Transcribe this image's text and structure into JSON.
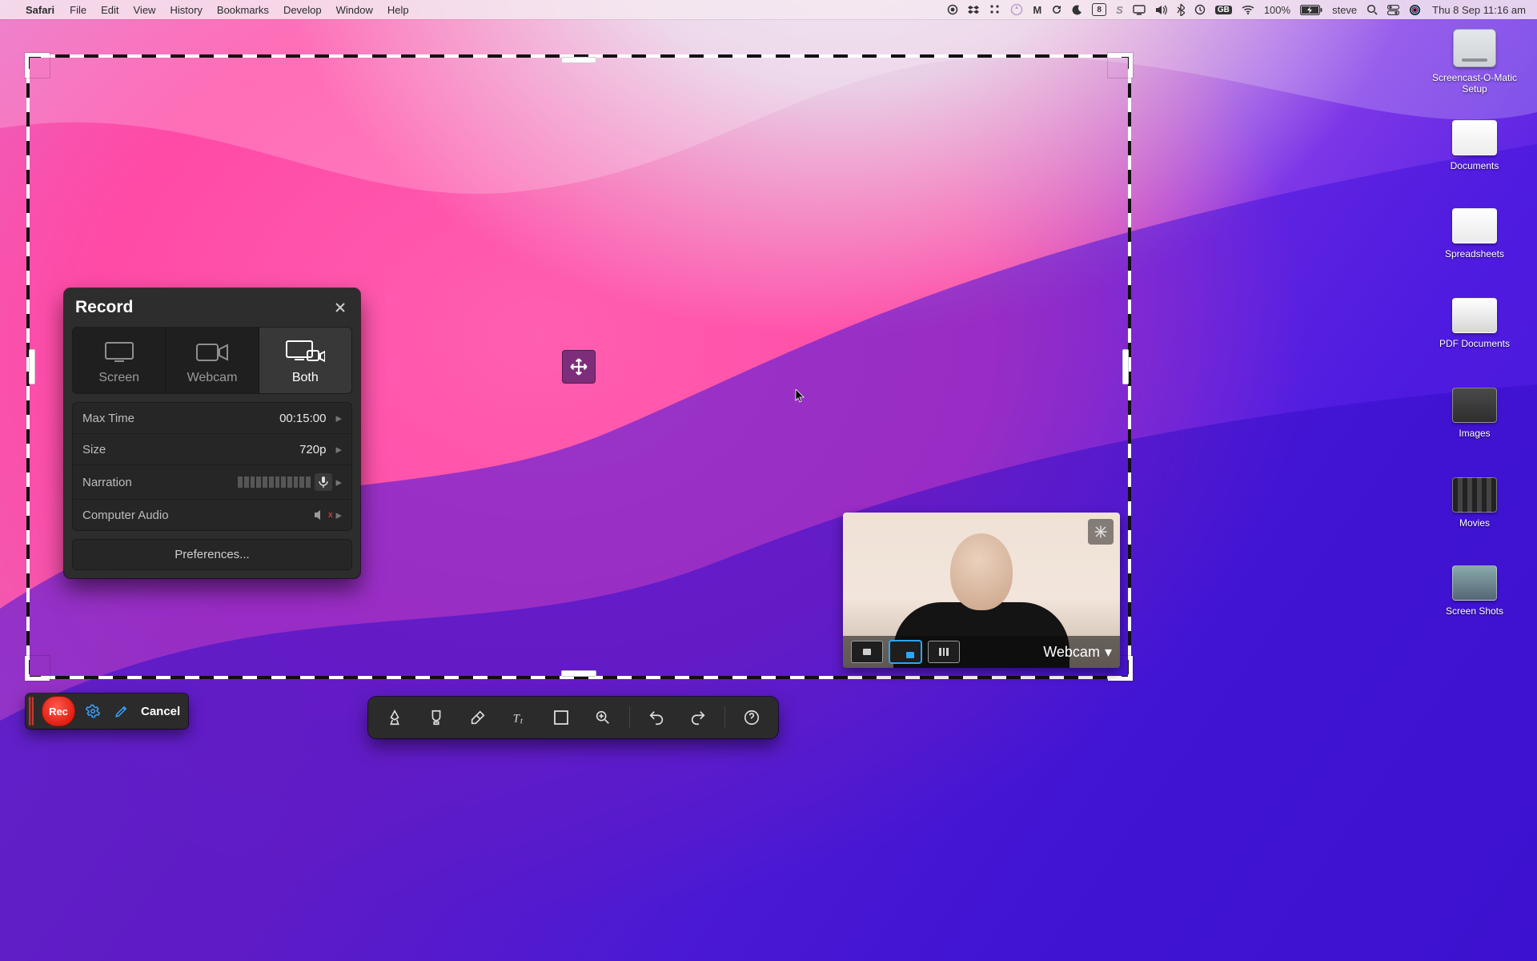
{
  "menubar": {
    "app": "Safari",
    "items": [
      "File",
      "Edit",
      "View",
      "History",
      "Bookmarks",
      "Develop",
      "Window",
      "Help"
    ],
    "battery_text": "100%",
    "user": "steve",
    "clock": "Thu 8 Sep  11:16 am",
    "input_source": "GB",
    "calendar_badge": "8"
  },
  "desktop_icons": [
    {
      "label": "Screencast-O-Matic Setup",
      "kind": "drive"
    },
    {
      "label": "Documents",
      "kind": "folder"
    },
    {
      "label": "Spreadsheets",
      "kind": "folder"
    },
    {
      "label": "PDF Documents",
      "kind": "folder"
    },
    {
      "label": "Images",
      "kind": "folder"
    },
    {
      "label": "Movies",
      "kind": "folder"
    },
    {
      "label": "Screen Shots",
      "kind": "folder"
    }
  ],
  "record_panel": {
    "title": "Record",
    "modes": {
      "screen": "Screen",
      "webcam": "Webcam",
      "both": "Both",
      "active": "both"
    },
    "rows": {
      "max_time": {
        "label": "Max Time",
        "value": "00:15:00"
      },
      "size": {
        "label": "Size",
        "value": "720p"
      },
      "narration": {
        "label": "Narration"
      },
      "computer_audio": {
        "label": "Computer Audio",
        "muted_indicator": "x"
      }
    },
    "preferences": "Preferences..."
  },
  "controls": {
    "rec": "Rec",
    "cancel": "Cancel"
  },
  "annotation_toolbar": {
    "tools": [
      "pen",
      "highlight",
      "erase",
      "text",
      "shape",
      "zoom",
      "undo",
      "redo",
      "help"
    ]
  },
  "webcam_preview": {
    "label": "Webcam"
  }
}
